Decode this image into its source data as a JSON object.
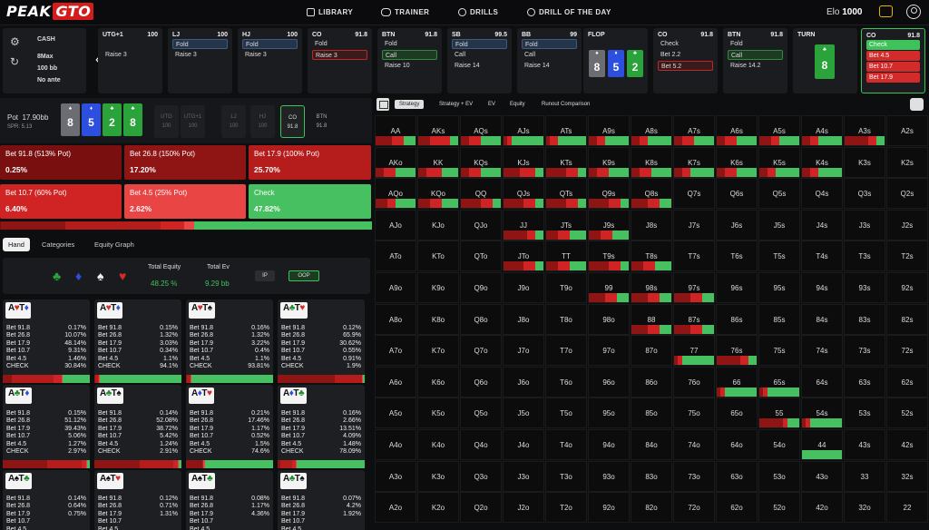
{
  "header": {
    "logo_a": "PEAK",
    "logo_b": "GTO",
    "nav": [
      {
        "label": "LIBRARY"
      },
      {
        "label": "TRAINER"
      },
      {
        "label": "DRILLS"
      },
      {
        "label": "DRILL OF THE DAY"
      }
    ],
    "elo_label": "Elo",
    "elo_value": "1000"
  },
  "info": {
    "game": "CASH",
    "format": "8Max",
    "stack": "100 bb",
    "ante": "No ante"
  },
  "action_cards": [
    {
      "pos": "UTG+1",
      "stack": "100",
      "opts": [
        "",
        "Raise 3"
      ]
    },
    {
      "pos": "LJ",
      "stack": "100",
      "opts": [
        "Fold",
        "Raise 3"
      ],
      "sel": 0
    },
    {
      "pos": "HJ",
      "stack": "100",
      "opts": [
        "Fold",
        "Raise 3"
      ],
      "sel": 0
    },
    {
      "pos": "CO",
      "stack": "91.8",
      "opts": [
        "Fold",
        "Raise 3"
      ],
      "selr": 1
    },
    {
      "pos": "BTN",
      "stack": "91.8",
      "opts": [
        "Fold",
        "Call",
        "Raise 10"
      ],
      "selg": 1
    },
    {
      "pos": "SB",
      "stack": "99.5",
      "opts": [
        "Fold",
        "Call",
        "Raise 14"
      ],
      "sel": 0
    },
    {
      "pos": "BB",
      "stack": "99",
      "opts": [
        "Fold",
        "Call",
        "Raise 14"
      ],
      "sel": 0
    },
    {
      "pos": "FLOP",
      "stack": "",
      "board": true
    },
    {
      "pos": "CO",
      "stack": "91.8",
      "opts": [
        "Check",
        "Bet 2.2",
        "Bet 5.2"
      ],
      "selr": 2
    },
    {
      "pos": "BTN",
      "stack": "91.8",
      "opts": [
        "Fold",
        "Call",
        "Raise 14.2"
      ],
      "selg": 1
    },
    {
      "pos": "TURN",
      "stack": "",
      "turn": true
    },
    {
      "pos": "CO",
      "stack": "91.8",
      "opts": [
        "Check",
        "Bet 4.5",
        "Bet 10.7",
        "Bet 17.9"
      ],
      "active": true
    }
  ],
  "flop": [
    {
      "r": "8",
      "c": "k",
      "s": "♠"
    },
    {
      "r": "5",
      "c": "b",
      "s": "♦"
    },
    {
      "r": "2",
      "c": "g",
      "s": "♣"
    }
  ],
  "turn": {
    "r": "8",
    "c": "g",
    "s": "♣"
  },
  "pot": {
    "label": "Pot",
    "value": "17.90bb",
    "spr": "SPR: 5.13"
  },
  "positions": [
    {
      "p": "UTG",
      "s": "100"
    },
    {
      "p": "UTG+1",
      "s": "100"
    },
    {
      "p": "LJ",
      "s": "100"
    },
    {
      "p": "HJ",
      "s": "100"
    },
    {
      "p": "CO",
      "s": "91.8"
    },
    {
      "p": "BTN",
      "s": "91.8"
    }
  ],
  "bets": [
    {
      "label": "Bet 91.8 (513% Pot)",
      "pct": "0.25%",
      "color": "#7a0f0f"
    },
    {
      "label": "Bet 26.8 (150% Pot)",
      "pct": "17.20%",
      "color": "#8f1414"
    },
    {
      "label": "Bet 17.9 (100% Pot)",
      "pct": "25.70%",
      "color": "#b51c1c"
    },
    {
      "label": "Bet 10.7 (60% Pot)",
      "pct": "6.40%",
      "color": "#d02424"
    },
    {
      "label": "Bet 4.5 (25% Pot)",
      "pct": "2.62%",
      "color": "#e94545"
    },
    {
      "label": "Check",
      "pct": "47.82%",
      "color": "#46c060"
    }
  ],
  "tabs": {
    "hand": "Hand",
    "categories": "Categories",
    "equity": "Equity Graph"
  },
  "equity": {
    "total_equity_label": "Total Equity",
    "total_equity": "48.25 %",
    "total_ev_label": "Total Ev",
    "total_ev": "9.29 bb",
    "ip": "IP",
    "oop": "OOP"
  },
  "combos": [
    {
      "h": [
        [
          "A",
          "♥",
          "hr"
        ],
        [
          "T",
          "♦",
          "hd"
        ]
      ],
      "v": [
        "0.17%",
        "10.07%",
        "48.14%",
        "9.31%",
        "1.46%",
        "30.84%"
      ]
    },
    {
      "h": [
        [
          "A",
          "♥",
          "hr"
        ],
        [
          "T",
          "♦",
          "hd"
        ]
      ],
      "v": [
        "0.15%",
        "1.32%",
        "3.03%",
        "0.34%",
        "1.1%",
        "94.1%"
      ]
    },
    {
      "h": [
        [
          "A",
          "♥",
          "hr"
        ],
        [
          "T",
          "♠",
          "hs"
        ]
      ],
      "v": [
        "0.16%",
        "1.32%",
        "3.22%",
        "0.4%",
        "1.1%",
        "93.81%"
      ]
    },
    {
      "h": [
        [
          "A",
          "♣",
          "hc"
        ],
        [
          "T",
          "♥",
          "hr"
        ]
      ],
      "v": [
        "0.12%",
        "65.9%",
        "30.62%",
        "0.55%",
        "0.91%",
        "1.9%"
      ]
    },
    {
      "h": [
        [
          "A",
          "♣",
          "hc"
        ],
        [
          "T",
          "♦",
          "hd"
        ]
      ],
      "v": [
        "0.15%",
        "51.12%",
        "39.43%",
        "5.06%",
        "1.27%",
        "2.97%"
      ],
      "check_red": true
    },
    {
      "h": [
        [
          "A",
          "♣",
          "hc"
        ],
        [
          "T",
          "♠",
          "hs"
        ]
      ],
      "v": [
        "0.14%",
        "52.08%",
        "38.72%",
        "5.42%",
        "1.24%",
        "2.91%"
      ],
      "check_red": true
    },
    {
      "h": [
        [
          "A",
          "♦",
          "hd"
        ],
        [
          "T",
          "♥",
          "hr"
        ]
      ],
      "v": [
        "0.21%",
        "17.46%",
        "1.17%",
        "0.52%",
        "1.5%",
        "74.6%"
      ]
    },
    {
      "h": [
        [
          "A",
          "♦",
          "hd"
        ],
        [
          "T",
          "♣",
          "hc"
        ]
      ],
      "v": [
        "0.16%",
        "2.66%",
        "13.51%",
        "4.09%",
        "1.48%",
        "78.09%"
      ]
    },
    {
      "h": [
        [
          "A",
          "♠",
          "hs"
        ],
        [
          "T",
          "♣",
          "hc"
        ]
      ],
      "v": [
        "0.14%",
        "0.64%",
        "0.75%",
        "",
        "",
        ""
      ]
    },
    {
      "h": [
        [
          "A",
          "♠",
          "hs"
        ],
        [
          "T",
          "♥",
          "hr"
        ]
      ],
      "v": [
        "0.12%",
        "0.71%",
        "1.31%",
        "",
        "",
        ""
      ]
    },
    {
      "h": [
        [
          "A",
          "♠",
          "hs"
        ],
        [
          "T",
          "♣",
          "hc"
        ]
      ],
      "v": [
        "0.08%",
        "1.17%",
        "4.36%",
        "",
        "",
        ""
      ]
    },
    {
      "h": [
        [
          "A",
          "♣",
          "hc"
        ],
        [
          "T",
          "♠",
          "hs"
        ]
      ],
      "v": [
        "0.07%",
        "4.2%",
        "1.92%",
        "",
        "",
        ""
      ]
    }
  ],
  "combo_labels": [
    "Bet 91.8",
    "Bet 26.8",
    "Bet 17.9",
    "Bet 10.7",
    "Bet 4.5",
    "CHECK"
  ],
  "matrix_tabs": [
    "Strategy",
    "Strategy + EV",
    "EV",
    "Equity",
    "Runout Comparison"
  ],
  "ranks": [
    "A",
    "K",
    "Q",
    "J",
    "T",
    "9",
    "8",
    "7",
    "6",
    "5",
    "4",
    "3",
    "2"
  ]
}
